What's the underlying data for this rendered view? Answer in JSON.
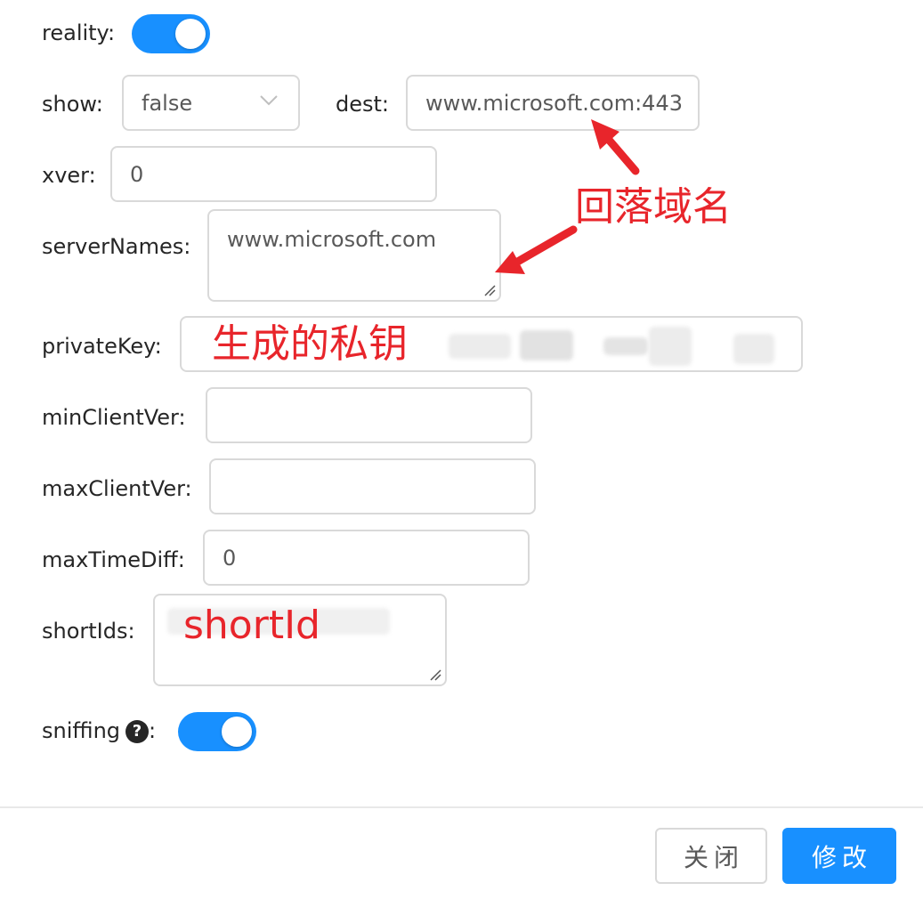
{
  "form": {
    "reality": {
      "label": "reality:",
      "enabled": true
    },
    "show": {
      "label": "show:",
      "value": "false"
    },
    "dest": {
      "label": "dest:",
      "value": "www.microsoft.com:443"
    },
    "xver": {
      "label": "xver:",
      "value": "0"
    },
    "serverNames": {
      "label": "serverNames:",
      "value": "www.microsoft.com"
    },
    "privateKey": {
      "label": "privateKey:"
    },
    "minClientVer": {
      "label": "minClientVer:",
      "value": ""
    },
    "maxClientVer": {
      "label": "maxClientVer:",
      "value": ""
    },
    "maxTimeDiff": {
      "label": "maxTimeDiff:",
      "value": "0"
    },
    "shortIds": {
      "label": "shortIds:"
    },
    "sniffing": {
      "label": "sniffing",
      "colon": ":",
      "help_icon": "question-circle-icon",
      "enabled": true
    }
  },
  "annotations": {
    "fallback_domain": "回落域名",
    "private_key": "生成的私钥",
    "short_id": "shortId",
    "color": "#e8252b"
  },
  "footer": {
    "close_label": "关闭",
    "submit_label": "修改"
  },
  "colors": {
    "primary": "#1890ff",
    "border": "#d9d9d9"
  }
}
